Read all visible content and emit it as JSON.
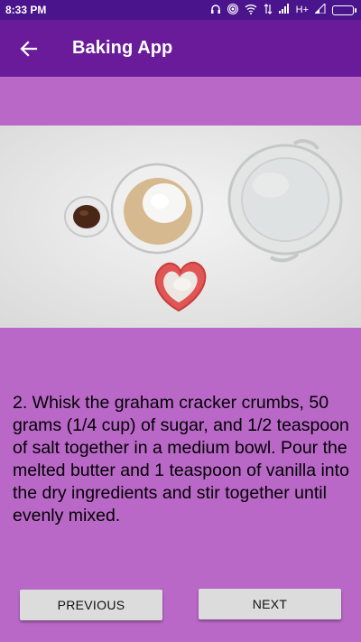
{
  "status_bar": {
    "time": "8:33 PM",
    "network_label": "H+"
  },
  "app_bar": {
    "title": "Baking App",
    "back_icon": "arrow-back-icon"
  },
  "step": {
    "description": "2. Whisk the graham cracker crumbs, 50 grams (1/4 cup) of sugar, and 1/2 teaspoon of salt together in a medium bowl. Pour the melted butter and 1 teaspoon of vanilla into the dry ingredients and stir together until evenly mixed."
  },
  "navigation": {
    "previous_label": "PREVIOUS",
    "next_label": "NEXT"
  },
  "colors": {
    "status_bar": "#4a148c",
    "app_bar": "#6a1b9a",
    "background": "#ba68c8",
    "button": "#dcdcdc"
  }
}
